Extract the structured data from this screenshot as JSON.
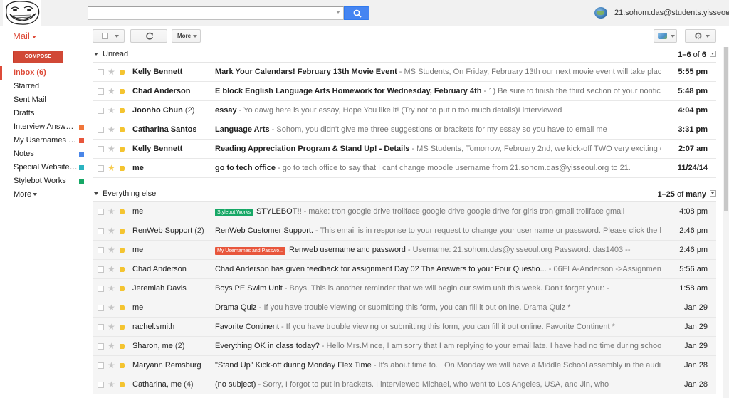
{
  "search": {
    "placeholder": ""
  },
  "account": {
    "email": "21.sohom.das@students.yisseoul.org"
  },
  "toolbar": {
    "app_label": "Mail",
    "more_label": "More"
  },
  "sidebar": {
    "compose_label": "COMPOSE",
    "items": [
      {
        "label": "Inbox (6)",
        "active": true
      },
      {
        "label": "Starred"
      },
      {
        "label": "Sent Mail"
      },
      {
        "label": "Drafts"
      },
      {
        "label": "Interview Answers ...",
        "color": "#f0763a"
      },
      {
        "label": "My Usernames an...",
        "color": "#e8563c"
      },
      {
        "label": "Notes",
        "color": "#4a86e8"
      },
      {
        "label": "Special Websites f...",
        "color": "#2bb3c0"
      },
      {
        "label": "Stylebot Works",
        "color": "#16a765"
      },
      {
        "label": "More"
      }
    ]
  },
  "sections": {
    "unread": {
      "title": "Unread",
      "range": "1–6",
      "of": "of",
      "total": "6"
    },
    "everything": {
      "title": "Everything else",
      "range": "1–25",
      "of": "of",
      "total": "many"
    }
  },
  "unread_emails": [
    {
      "sender": "Kelly Bennett",
      "count": "",
      "subject": "Mark Your Calendars! February 13th Movie Event",
      "snippet": " - MS Students, On Friday, February 13th our next movie event will take place after-school be",
      "date": "5:55 pm",
      "starred": false
    },
    {
      "sender": "Chad Anderson",
      "count": "",
      "subject": "E block English Language Arts Homework for Wednesday, February 4th",
      "snippet": " - 1) Be sure to finish the third section of your nonfiction book. 2) Be",
      "date": "5:48 pm",
      "starred": false
    },
    {
      "sender": "Joonho Chun",
      "count": " (2)",
      "subject": "essay",
      "snippet": " - Yo dawg here is your essay, Hope You like it! (Try not to put n too much details)I interviewed",
      "date": "4:04 pm",
      "starred": false
    },
    {
      "sender": "Catharina Santos",
      "count": "",
      "subject": "Language Arts",
      "snippet": " - Sohom, you didn't give me three suggestions or brackets for my essay so you have to email me",
      "date": "3:31 pm",
      "starred": false
    },
    {
      "sender": "Kelly Bennett",
      "count": "",
      "subject": "Reading Appreciation Program & Stand Up! - Details",
      "snippet": " - MS Students, Tomorrow, February 2nd, we kick-off TWO very exciting events.... Readin",
      "date": "2:07 am",
      "starred": false
    },
    {
      "sender": "me",
      "count": "",
      "subject": "go to tech office",
      "snippet": " - go to tech office to say that I cant change moodle username from 21.sohom.das@yisseoul.org to 21.",
      "date": "11/24/14",
      "starred": true
    }
  ],
  "other_emails": [
    {
      "sender": "me",
      "count": "",
      "label": "Stylebot Works",
      "label_color": "#16a765",
      "subject": "STYLEBOT!!",
      "snippet": " - make: tron google drive trollface google drive google drive for girls tron gmail trollface gmail",
      "date": "4:08 pm"
    },
    {
      "sender": "RenWeb Support",
      "count": " (2)",
      "label": "",
      "subject": "RenWeb Customer Support.",
      "snippet": " - This email is in response to your request to change your user name or password. Please click the link",
      "date": "2:46 pm"
    },
    {
      "sender": "me",
      "count": "",
      "label": "My Usernames and Passwo...",
      "label_color": "#e8563c",
      "subject": "Renweb username and password",
      "snippet": " - Username: 21.sohom.das@yisseoul.org Password: das1403 --",
      "date": "2:46 pm"
    },
    {
      "sender": "Chad Anderson",
      "count": "",
      "label": "",
      "subject": "Chad Anderson has given feedback for assignment Day 02 The Answers to your Four Questio...",
      "snippet": " - 06ELA-Anderson ->Assignment ->Day 02 The A",
      "date": "5:56 am"
    },
    {
      "sender": "Jeremiah Davis",
      "count": "",
      "label": "",
      "subject": "Boys PE Swim Unit",
      "snippet": " - Boys, This is another reminder that we will begin our swim unit this week. Don't forget your: -",
      "date": "1:58 am"
    },
    {
      "sender": "me",
      "count": "",
      "label": "",
      "subject": "Drama Quiz",
      "snippet": " - If you have trouble viewing or submitting this form, you can fill it out online. Drama Quiz *",
      "date": "Jan 29"
    },
    {
      "sender": "rachel.smith",
      "count": "",
      "label": "",
      "subject": "Favorite Continent",
      "snippet": " - If you have trouble viewing or submitting this form, you can fill it out online. Favorite Continent *",
      "date": "Jan 29"
    },
    {
      "sender": "Sharon, me",
      "count": " (2)",
      "label": "",
      "subject": "Everything OK in class today?",
      "snippet": " - Hello Mrs.Mince, I am sorry that I am replying to your email late. I have had no time during school",
      "date": "Jan 29"
    },
    {
      "sender": "Maryann Remsburg",
      "count": "",
      "label": "",
      "subject": "\"Stand Up\" Kick-off during Monday Flex Time",
      "snippet": " - It's about time to... On Monday we will have a Middle School assembly in the auditorium during",
      "date": "Jan 28"
    },
    {
      "sender": "Catharina, me",
      "count": " (4)",
      "label": "",
      "subject": "(no subject)",
      "snippet": " - Sorry, I forgot to put in brackets. I interviewed Michael, who went to Los Angeles, USA, and Jin, who",
      "date": "Jan 28"
    }
  ]
}
